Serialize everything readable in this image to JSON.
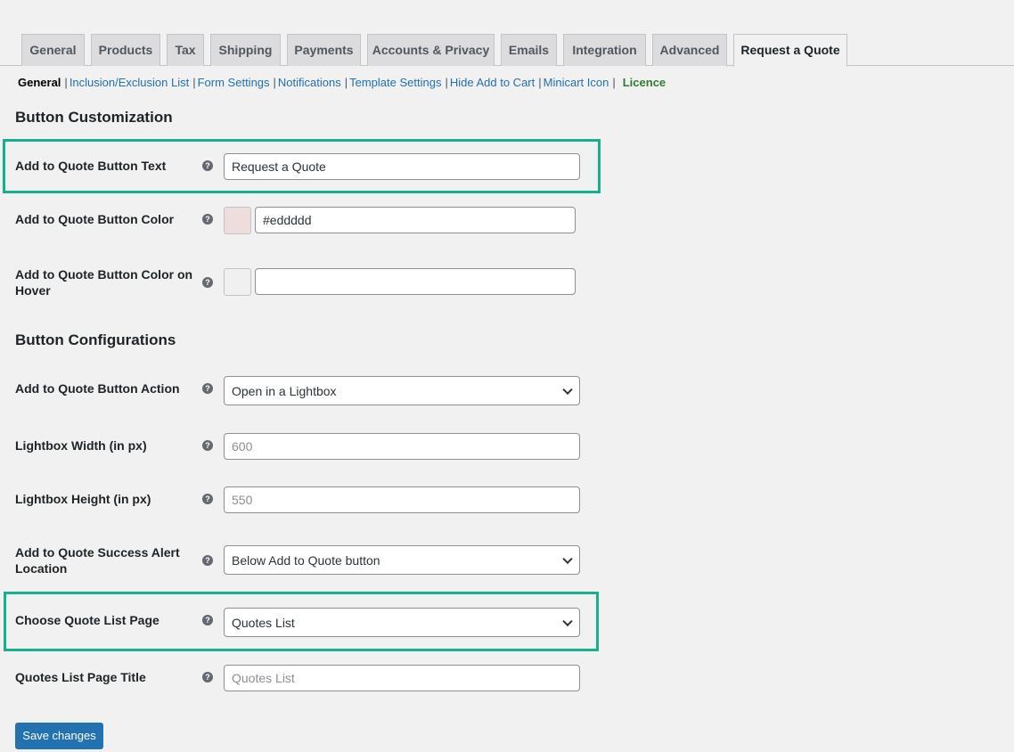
{
  "tabs": [
    {
      "label": "General"
    },
    {
      "label": "Products"
    },
    {
      "label": "Tax"
    },
    {
      "label": "Shipping"
    },
    {
      "label": "Payments"
    },
    {
      "label": "Accounts & Privacy"
    },
    {
      "label": "Emails"
    },
    {
      "label": "Integration"
    },
    {
      "label": "Advanced"
    },
    {
      "label": "Request a Quote",
      "active": true
    }
  ],
  "subnav": {
    "general": "General",
    "inclusion": "Inclusion/Exclusion List",
    "form_settings": "Form Settings",
    "notifications": "Notifications",
    "template_settings": "Template Settings",
    "hide_add_to_cart": "Hide Add to Cart",
    "minicart_icon": "Minicart Icon",
    "licence": "Licence",
    "separator": "|"
  },
  "sections": {
    "customization": "Button Customization",
    "configurations": "Button Configurations"
  },
  "fields": {
    "button_text": {
      "label": "Add to Quote Button Text",
      "value": "Request a Quote"
    },
    "button_color": {
      "label": "Add to Quote Button Color",
      "value": "#eddddd",
      "swatch": "#eddddd"
    },
    "button_hover_color": {
      "label": "Add to Quote Button Color on Hover",
      "value": "",
      "swatch": "#f0f0f0"
    },
    "button_action": {
      "label": "Add to Quote Button Action",
      "value": "Open in a Lightbox"
    },
    "lightbox_width": {
      "label": "Lightbox Width (in px)",
      "placeholder": "600"
    },
    "lightbox_height": {
      "label": "Lightbox Height (in px)",
      "placeholder": "550"
    },
    "success_alert": {
      "label": "Add to Quote Success Alert Location",
      "value": "Below Add to Quote button"
    },
    "quote_list_page": {
      "label": "Choose Quote List Page",
      "value": "Quotes List"
    },
    "quote_list_title": {
      "label": "Quotes List Page Title",
      "placeholder": "Quotes List"
    }
  },
  "help_glyph": "?",
  "save_label": "Save changes",
  "colors": {
    "highlight": "#17b08d",
    "primary": "#2271b1"
  }
}
